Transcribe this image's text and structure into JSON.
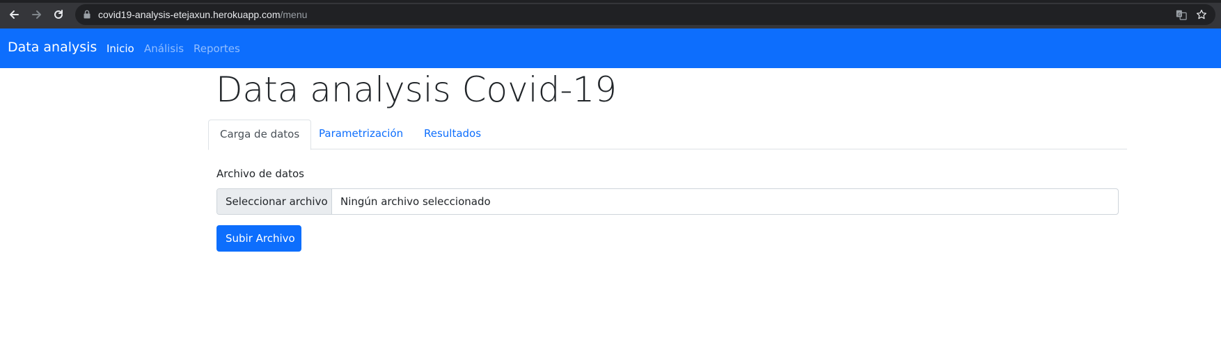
{
  "browser": {
    "url_host": "covid19-analysis-etejaxun.herokuapp.com",
    "url_path": "/menu",
    "icons": {
      "back": "back-arrow-icon",
      "forward": "forward-arrow-icon",
      "reload": "reload-icon",
      "lock": "lock-icon",
      "translate": "translate-icon",
      "bookmark": "star-icon"
    }
  },
  "navbar": {
    "brand": "Data analysis",
    "links": [
      {
        "label": "Inicio",
        "active": true
      },
      {
        "label": "Análisis",
        "active": false
      },
      {
        "label": "Reportes",
        "active": false
      }
    ],
    "color": "#0d6efd"
  },
  "main": {
    "title": "Data analysis Covid-19",
    "tabs": [
      {
        "label": "Carga de datos",
        "active": true
      },
      {
        "label": "Parametrización",
        "active": false
      },
      {
        "label": "Resultados",
        "active": false
      }
    ],
    "file_label": "Archivo de datos",
    "file_button": "Seleccionar archivo",
    "file_status": "Ningún archivo seleccionado",
    "submit_label": "Subir Archivo"
  }
}
